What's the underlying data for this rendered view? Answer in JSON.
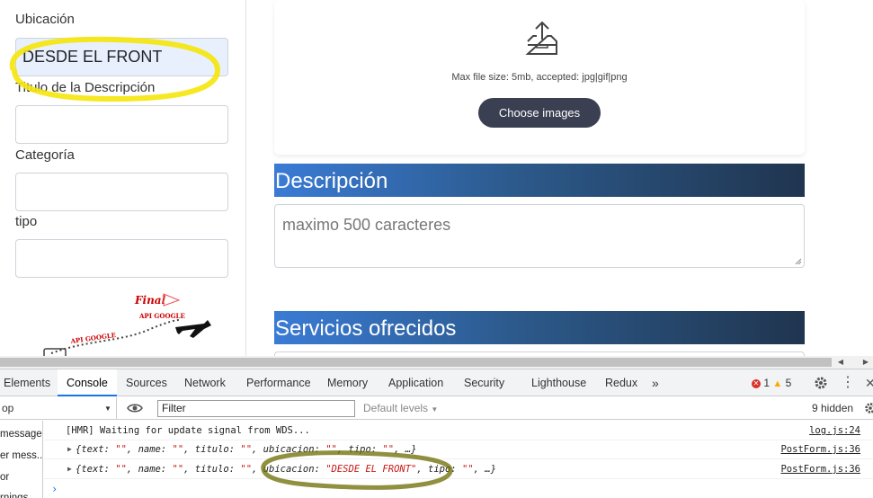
{
  "form": {
    "ubicacion_label": "Ubicación",
    "ubicacion_value": "DESDE EL FRONT",
    "titulo_label": "Titulo de la Descripción",
    "categoria_label": "Categoría",
    "tipo_label": "tipo",
    "map_labels": {
      "final": "Final",
      "api_google_top": "API GOOGLE",
      "api_google_bottom": "API GOOGLE"
    }
  },
  "upload": {
    "max_size_text": "Max file size: 5mb, accepted: jpg|gif|png",
    "choose_button": "Choose images"
  },
  "sections": {
    "descripcion_title": "Descripción",
    "descripcion_placeholder": "maximo 500 caracteres",
    "servicios_title": "Servicios ofrecidos"
  },
  "devtools": {
    "tabs": [
      "Elements",
      "Console",
      "Sources",
      "Network",
      "Performance",
      "Memory",
      "Application",
      "Security",
      "Lighthouse",
      "Redux"
    ],
    "active_tab": "Console",
    "more_tabs": "»",
    "error_count": "1",
    "warning_count": "5",
    "context_value": "op",
    "filter_placeholder": "Filter",
    "levels_label": "Default levels",
    "hidden_count": "9 hidden",
    "sidebar_items": [
      "messages",
      "er mess...",
      "or",
      "rnings"
    ],
    "console_rows": [
      {
        "text": "[HMR] Waiting for update signal from WDS...",
        "source": "log.js:24"
      },
      {
        "text_parts": [
          "{text: ",
          "\"\"",
          ", name: ",
          "\"\"",
          ", titulo: ",
          "\"\"",
          ", ubicacion: ",
          "\"\"",
          ", tipo: ",
          "\"\"",
          ", …}"
        ],
        "source": "PostForm.js:36"
      },
      {
        "text_parts": [
          "{text: ",
          "\"\"",
          ", name: ",
          "\"\"",
          ", titulo: ",
          "\"\"",
          ", ubicacion: ",
          "\"DESDE EL FRONT\"",
          ", tipo: ",
          "\"\"",
          ", …}"
        ],
        "source": "PostForm.js:36"
      }
    ],
    "prompt": "›"
  },
  "colors": {
    "highlight": "#f5e60a",
    "button_bg": "#3a3f51",
    "section_gradient_start": "#3a7bd5",
    "section_gradient_end": "#20354f",
    "string_color": "#c41a16",
    "active_tab_underline": "#1a73e8"
  }
}
